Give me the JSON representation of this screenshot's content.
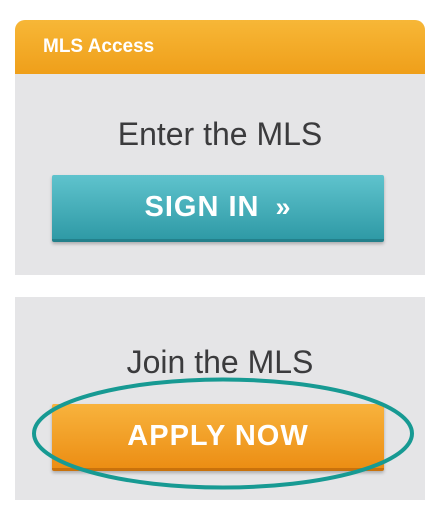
{
  "mls_access": {
    "header": "MLS Access",
    "heading": "Enter the MLS",
    "signin_label": "SIGN IN",
    "signin_icon": "»"
  },
  "join": {
    "heading": "Join the MLS",
    "apply_label": "APPLY NOW"
  },
  "colors": {
    "header_orange": "#f2a624",
    "signin_teal": "#3ba9b4",
    "apply_orange": "#f09a22",
    "panel_gray": "#e5e5e7",
    "highlight_teal": "#179a93"
  }
}
